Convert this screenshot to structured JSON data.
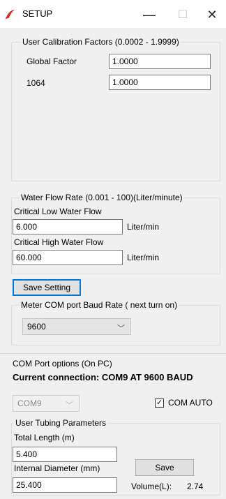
{
  "window": {
    "title": "SETUP",
    "minimize_glyph": "—",
    "maximize_glyph": "☐",
    "close_glyph": "✕",
    "logo_icon": "red-swoosh-logo-icon",
    "logo_color": "#d42a2a"
  },
  "calibration": {
    "legend": "User Calibration Factors (0.0002 - 1.9999)",
    "rows": [
      {
        "label": "Global Factor",
        "value": "1.0000"
      },
      {
        "label": "1064",
        "value": "1.0000"
      }
    ]
  },
  "water_flow": {
    "legend": "Water Flow  Rate (0.001 -  100)(Liter/minute)",
    "low_label": "Critical Low Water Flow",
    "low_value": "6.000",
    "low_unit": "Liter/min",
    "high_label": "Critical High Water Flow",
    "high_value": "60.000",
    "high_unit": "Liter/min"
  },
  "save_setting_label": "Save Setting",
  "baud": {
    "legend": "Meter COM port Baud Rate ( next turn on)",
    "selected": "9600"
  },
  "com_port": {
    "options_label": "COM Port  options (On PC)",
    "current_connection": "Current connection: COM9 AT 9600 BAUD",
    "port_selected": "COM9",
    "auto_label": "COM AUTO",
    "auto_checked": true
  },
  "tubing": {
    "legend": "User Tubing Parameters",
    "length_label": "Total Length (m)",
    "length_value": "5.400",
    "diameter_label": "Internal Diameter (mm)",
    "diameter_value": "25.400",
    "save_label": "Save",
    "volume_label": "Volume(L):",
    "volume_value": "2.74"
  },
  "colors": {
    "accent": "#0078d7",
    "window_bg": "#f0f0f0"
  }
}
